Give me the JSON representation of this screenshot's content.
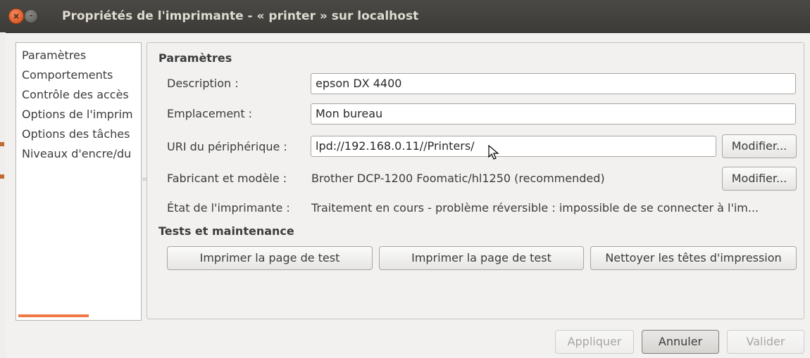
{
  "window": {
    "title": "Propriétés de l'imprimante - « printer » sur localhost"
  },
  "sidebar": {
    "items": [
      {
        "label": "Paramètres"
      },
      {
        "label": "Comportements"
      },
      {
        "label": "Contrôle des accès"
      },
      {
        "label": "Options de l'imprim"
      },
      {
        "label": "Options des tâches"
      },
      {
        "label": "Niveaux d'encre/du"
      }
    ]
  },
  "settings": {
    "section_title": "Paramètres",
    "description_label": "Description :",
    "description_value": "epson DX 4400",
    "location_label": "Emplacement :",
    "location_value": "Mon bureau",
    "uri_label": "URI du périphérique :",
    "uri_value": "lpd://192.168.0.11//Printers/",
    "uri_modify": "Modifier...",
    "make_label": "Fabricant et modèle :",
    "make_value": "Brother DCP-1200 Foomatic/hl1250 (recommended)",
    "make_modify": "Modifier...",
    "state_label": "État de l'imprimante :",
    "state_value": "Traitement en cours - problème réversible : impossible de se connecter à l'im..."
  },
  "tests": {
    "section_title": "Tests et maintenance",
    "button1": "Imprimer la page de test",
    "button2": "Imprimer la page de test",
    "button3": "Nettoyer les têtes d'impression"
  },
  "footer": {
    "apply": "Appliquer",
    "cancel": "Annuler",
    "ok": "Valider"
  },
  "colors": {
    "titlebar": "#3c3b37",
    "close_button": "#e95420",
    "accent": "#f07746"
  }
}
